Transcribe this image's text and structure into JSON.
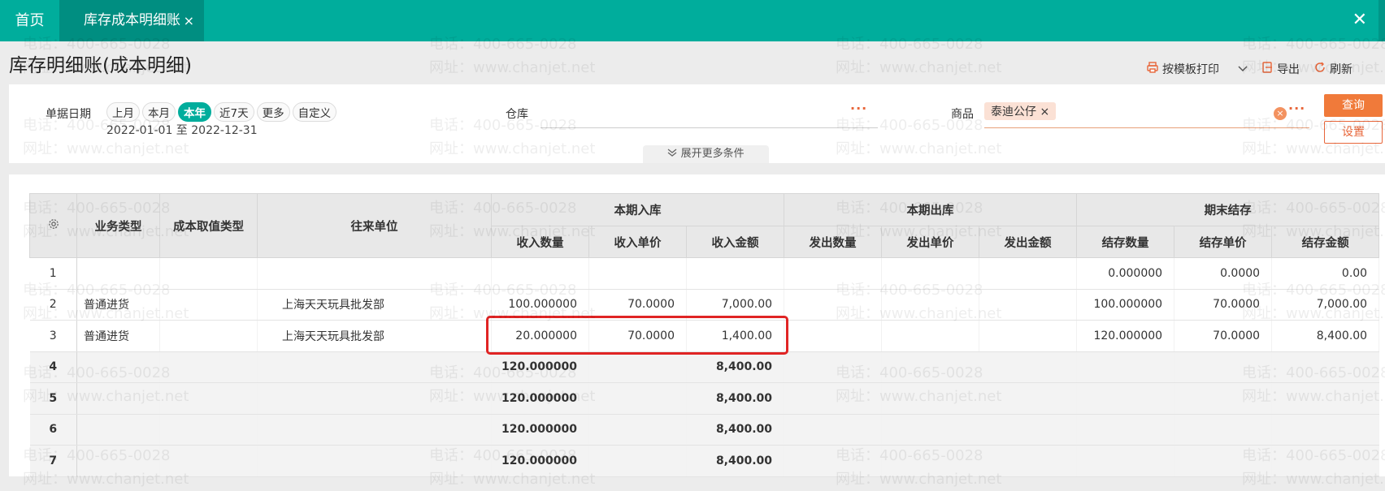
{
  "tabs": {
    "home": "首页",
    "active": "库存成本明细账",
    "close": "×"
  },
  "window": {
    "close": "✕"
  },
  "page": {
    "title": "库存明细账(成本明细)"
  },
  "toolbar": {
    "print": "按模板打印",
    "export": "导出",
    "refresh": "刷新"
  },
  "filter": {
    "date_label": "单据日期",
    "quick": [
      "上月",
      "本月",
      "本年",
      "近7天",
      "更多",
      "自定义"
    ],
    "active_quick": "本年",
    "date_range": "2022-01-01 至 2022-12-31",
    "warehouse_label": "仓库",
    "product_label": "商品",
    "product_tag": "泰迪公仔",
    "query": "查询",
    "setting": "设置",
    "expand": "展开更多条件"
  },
  "table": {
    "headers": {
      "biz_type": "业务类型",
      "cost_type": "成本取值类型",
      "partner": "往来单位",
      "in_group": "本期入库",
      "out_group": "本期出库",
      "end_group": "期末结存",
      "in_qty": "收入数量",
      "in_price": "收入单价",
      "in_amt": "收入金额",
      "out_qty": "发出数量",
      "out_price": "发出单价",
      "out_amt": "发出金额",
      "end_qty": "结存数量",
      "end_price": "结存单价",
      "end_amt": "结存金额"
    },
    "rows": [
      {
        "idx": "1",
        "biz": "",
        "cost": "",
        "partner": "",
        "in_qty": "",
        "in_price": "",
        "in_amt": "",
        "out_qty": "",
        "out_price": "",
        "out_amt": "",
        "end_qty": "0.000000",
        "end_price": "0.0000",
        "end_amt": "0.00"
      },
      {
        "idx": "2",
        "biz": "普通进货",
        "cost": "",
        "partner": "上海天天玩具批发部",
        "in_qty": "100.000000",
        "in_price": "70.0000",
        "in_amt": "7,000.00",
        "out_qty": "",
        "out_price": "",
        "out_amt": "",
        "end_qty": "100.000000",
        "end_price": "70.0000",
        "end_amt": "7,000.00"
      },
      {
        "idx": "3",
        "biz": "普通进货",
        "cost": "",
        "partner": "上海天天玩具批发部",
        "in_qty": "20.000000",
        "in_price": "70.0000",
        "in_amt": "1,400.00",
        "out_qty": "",
        "out_price": "",
        "out_amt": "",
        "end_qty": "120.000000",
        "end_price": "70.0000",
        "end_amt": "8,400.00"
      },
      {
        "idx": "4",
        "biz": "",
        "cost": "",
        "partner": "",
        "in_qty": "120.000000",
        "in_price": "",
        "in_amt": "8,400.00",
        "out_qty": "",
        "out_price": "",
        "out_amt": "",
        "end_qty": "",
        "end_price": "",
        "end_amt": ""
      },
      {
        "idx": "5",
        "biz": "",
        "cost": "",
        "partner": "",
        "in_qty": "120.000000",
        "in_price": "",
        "in_amt": "8,400.00",
        "out_qty": "",
        "out_price": "",
        "out_amt": "",
        "end_qty": "",
        "end_price": "",
        "end_amt": ""
      },
      {
        "idx": "6",
        "biz": "",
        "cost": "",
        "partner": "",
        "in_qty": "120.000000",
        "in_price": "",
        "in_amt": "8,400.00",
        "out_qty": "",
        "out_price": "",
        "out_amt": "",
        "end_qty": "",
        "end_price": "",
        "end_amt": ""
      },
      {
        "idx": "7",
        "biz": "",
        "cost": "",
        "partner": "",
        "in_qty": "120.000000",
        "in_price": "",
        "in_amt": "8,400.00",
        "out_qty": "",
        "out_price": "",
        "out_amt": "",
        "end_qty": "",
        "end_price": "",
        "end_amt": ""
      }
    ]
  },
  "watermark": {
    "phone": "电话：400-665-0028",
    "site": "网址：www.chanjet.net"
  },
  "colors": {
    "brand": "#00ad9c",
    "accent": "#e8663a",
    "highlight": "#e02424"
  }
}
